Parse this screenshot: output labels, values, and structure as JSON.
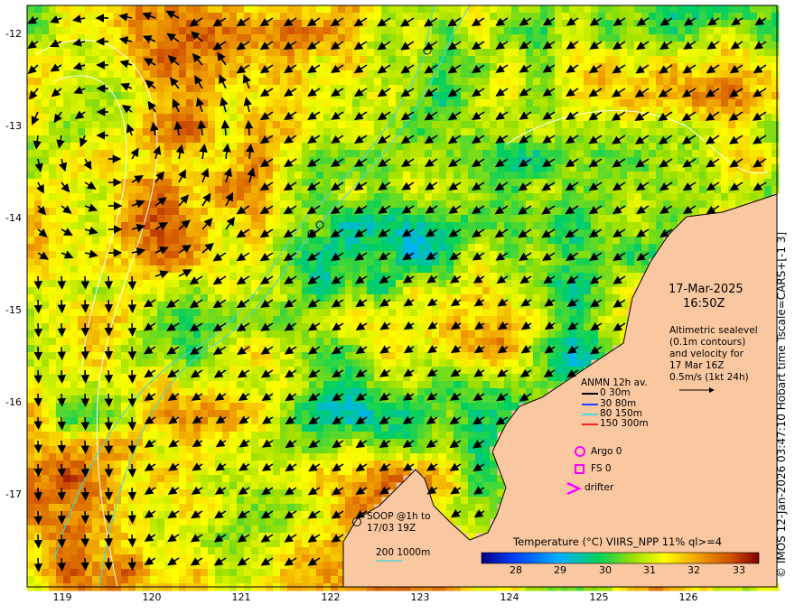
{
  "map": {
    "y_ticks": [
      "-12",
      "-13",
      "-14",
      "-15",
      "-16",
      "-17"
    ],
    "x_ticks": [
      "119",
      "120",
      "121",
      "122",
      "123",
      "124",
      "125",
      "126"
    ]
  },
  "info": {
    "date": "17-Mar-2025",
    "time": "16:50Z",
    "altimetry_lines": [
      "Altimetric sealevel",
      "(0.1m contours)",
      "and velocity for",
      "17 Mar 16Z",
      "0.5m/s (1kt 24h)"
    ]
  },
  "legend": {
    "anmn_title": "ANMN 12h av.",
    "depths": [
      {
        "label": "0 30m",
        "color": "#000000"
      },
      {
        "label": "30 80m",
        "color": "#1a3cff"
      },
      {
        "label": "80 150m",
        "color": "#40e0e0"
      },
      {
        "label": "150 300m",
        "color": "#ff2020"
      }
    ],
    "argo": "Argo 0",
    "fs": "FS 0",
    "drifter": "drifter",
    "marker_color": "#ff00ff",
    "soop_line1": "SOOP @1h to",
    "soop_line2": "17/03 19Z",
    "isobaths": "200  1000m",
    "isobath_color": "#40d8e0"
  },
  "colorbar": {
    "title": "Temperature (°C) VIIRS_NPP 11% ql>=4",
    "ticks": [
      "28",
      "29",
      "30",
      "31",
      "32",
      "33"
    ],
    "range": [
      27.4,
      33.4
    ]
  },
  "credit": "© IMOS 12-Jan-2026 03:47:10 Hobart time Tscale=CARS+[-1 3]"
}
